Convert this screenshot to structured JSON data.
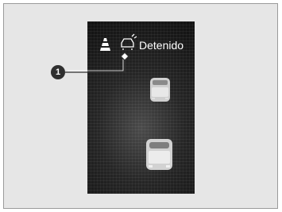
{
  "display": {
    "status_text": "Detenido",
    "icons": [
      "lane-cone-icon",
      "stopped-vehicle-icon"
    ]
  },
  "callout": {
    "number": "1"
  },
  "colors": {
    "background": "#e6e6e6",
    "display": "#1e1e1e",
    "text": "#ffffff",
    "callout": "#2f2f2f"
  }
}
